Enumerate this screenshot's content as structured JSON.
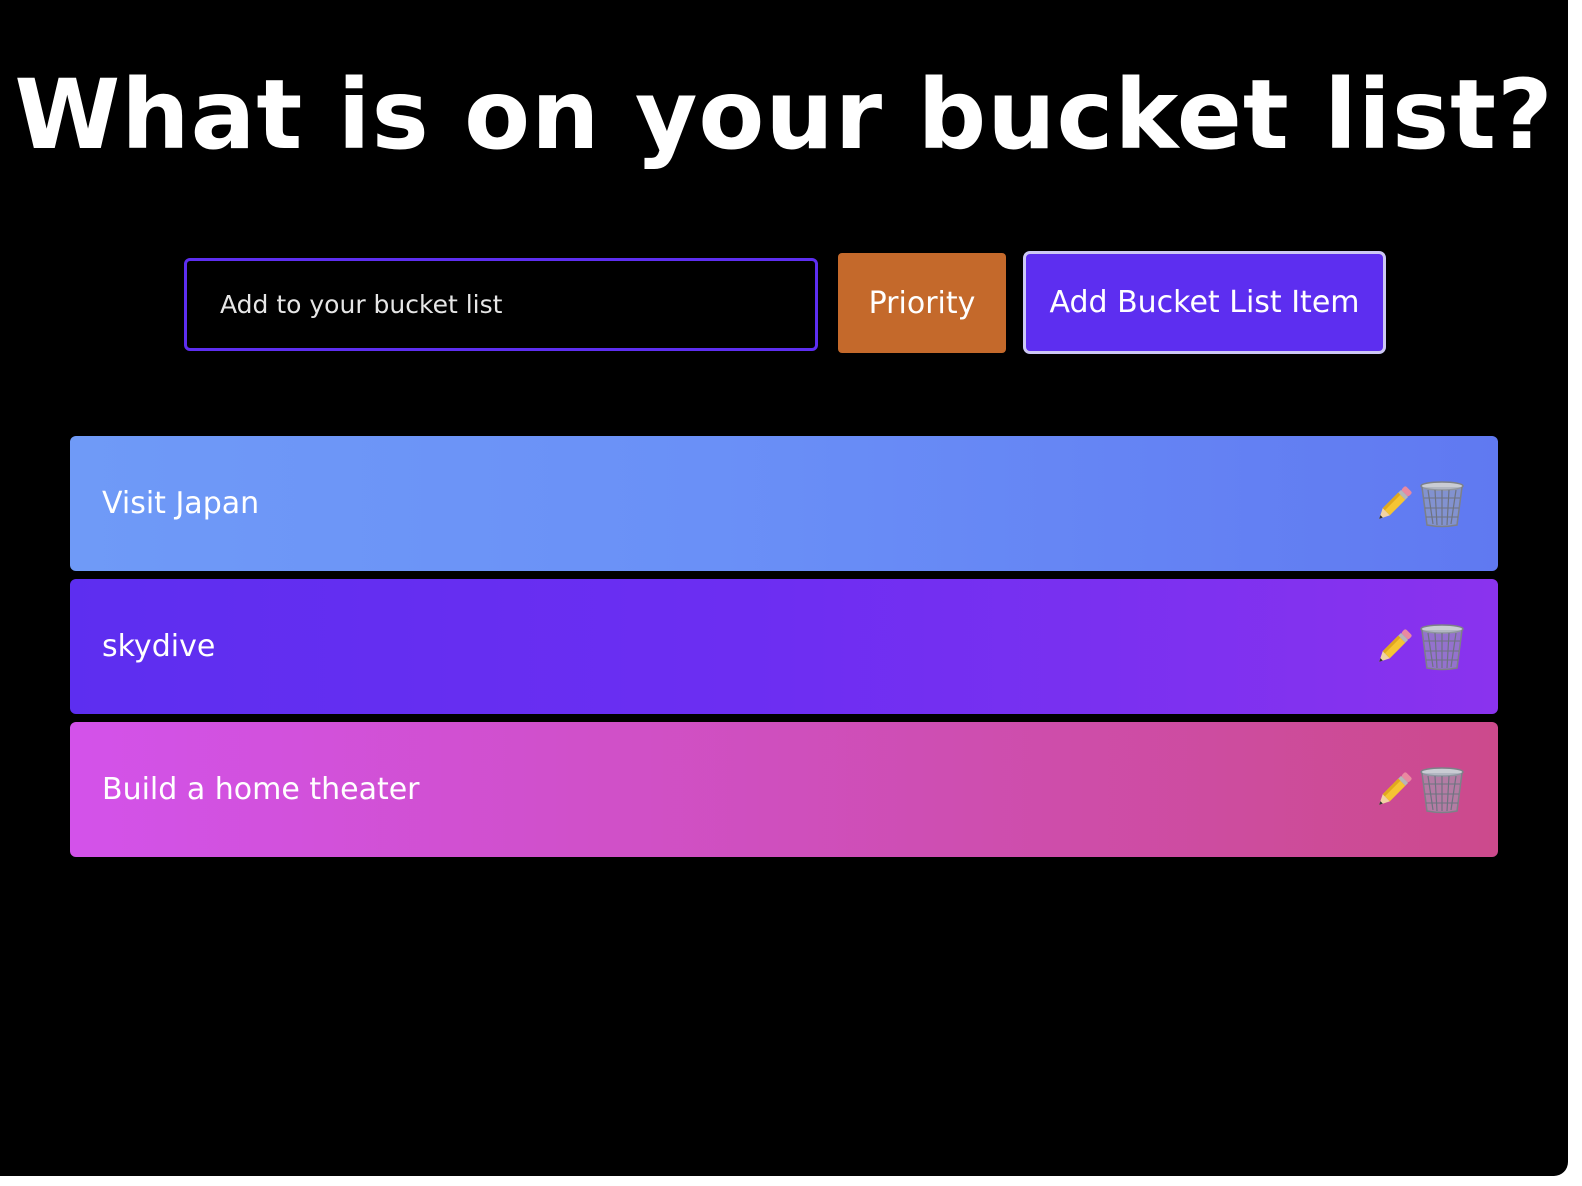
{
  "header": {
    "title": "What is on your bucket list?"
  },
  "form": {
    "placeholder": "Add to your bucket list",
    "value": "",
    "priority_label": "Priority",
    "add_label": "Add Bucket List Item"
  },
  "items": [
    {
      "label": "Visit Japan",
      "edit_icon": "pencil-icon",
      "delete_icon": "trash-icon"
    },
    {
      "label": "skydive",
      "edit_icon": "pencil-icon",
      "delete_icon": "trash-icon"
    },
    {
      "label": "Build a home theater",
      "edit_icon": "pencil-icon",
      "delete_icon": "trash-icon"
    }
  ],
  "colors": {
    "background": "#000000",
    "accent": "#5d2ef0",
    "priority": "#c4692b",
    "item_1": "#6a90f7",
    "item_2": "#6d2ef2",
    "item_3": "#cf4fbd"
  }
}
